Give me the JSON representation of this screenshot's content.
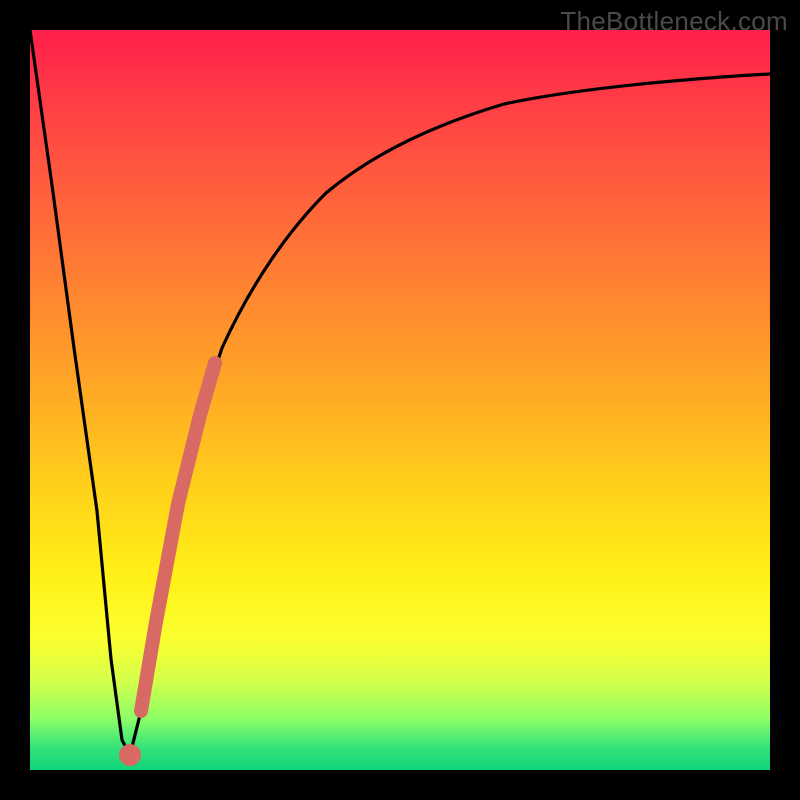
{
  "watermark": "TheBottleneck.com",
  "colors": {
    "frame": "#000000",
    "curve_main": "#000000",
    "highlight_stroke": "#d96a63",
    "highlight_dot": "#d96a63"
  },
  "chart_data": {
    "type": "line",
    "title": "",
    "xlabel": "",
    "ylabel": "",
    "xlim": [
      0,
      100
    ],
    "ylim": [
      0,
      100
    ],
    "series": [
      {
        "name": "bottleneck-curve",
        "x": [
          0,
          3,
          6,
          9,
          11,
          12.5,
          13.5,
          15,
          17,
          20,
          23,
          26,
          30,
          35,
          40,
          46,
          54,
          64,
          78,
          100
        ],
        "y": [
          100,
          79,
          57,
          35,
          15,
          4,
          2,
          8,
          20,
          36,
          48,
          57,
          66,
          73,
          78,
          83,
          87,
          90,
          92.5,
          94
        ]
      },
      {
        "name": "highlight-segment",
        "x": [
          15,
          17,
          20,
          23,
          25
        ],
        "y": [
          8,
          20,
          36,
          48,
          55
        ]
      }
    ],
    "annotations": [
      {
        "name": "minimum-dot",
        "x": 13.5,
        "y": 2
      }
    ]
  }
}
